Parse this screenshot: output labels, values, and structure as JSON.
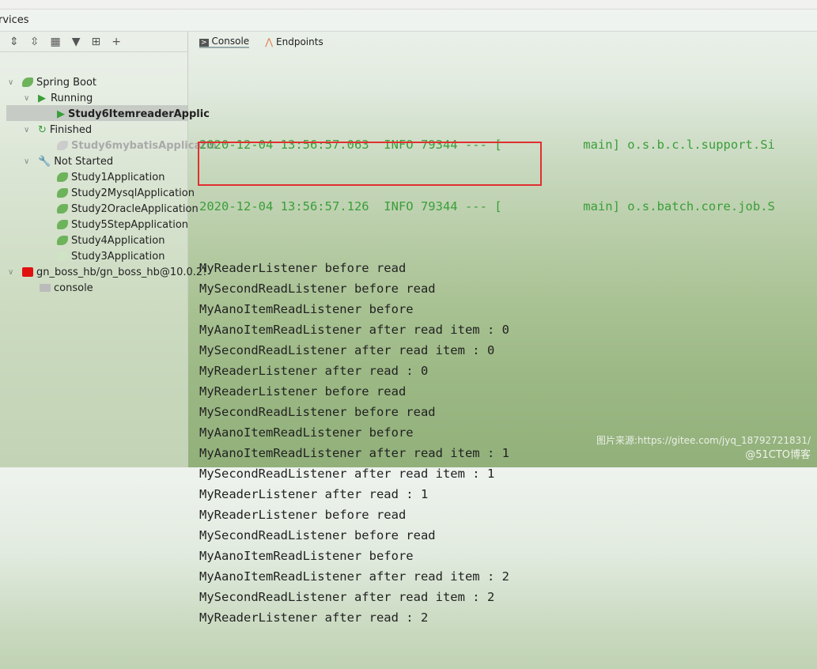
{
  "window": {
    "title": "rvices"
  },
  "toolbar": {
    "icons": [
      "expand-all-icon",
      "collapse-all-icon",
      "group-icon",
      "filter-icon",
      "add-service-icon",
      "add-icon"
    ]
  },
  "tabs": [
    {
      "label": "Console",
      "icon": "console-icon"
    },
    {
      "label": "Endpoints",
      "icon": "endpoints-icon"
    }
  ],
  "tree": {
    "spring_boot": "Spring Boot",
    "running": "Running",
    "running_app": "Study6ItemreaderApplic",
    "finished": "Finished",
    "finished_app": "Study6mybatisApplicatio",
    "not_started": "Not Started",
    "apps": [
      "Study1Application",
      "Study2MysqlApplication",
      "Study2OracleApplication",
      "Study5StepApplication",
      "Study4Application",
      "Study3Application"
    ],
    "db": "gn_boss_hb/gn_boss_hb@10.0.2!",
    "db_console": "console"
  },
  "console": {
    "log_lines": [
      "2020-12-04 13:56:57.063  INFO 79344 --- [           main] o.s.b.c.l.support.Si",
      "2020-12-04 13:56:57.126  INFO 79344 --- [           main] o.s.batch.core.job.S"
    ],
    "lines": [
      "MyReaderListener before read",
      "MySecondReadListener before read",
      "MyAanoItemReadListener before",
      "MyAanoItemReadListener after read item : 0",
      "MySecondReadListener after read item : 0",
      "MyReaderListener after read : 0",
      "MyReaderListener before read",
      "MySecondReadListener before read",
      "MyAanoItemReadListener before",
      "MyAanoItemReadListener after read item : 1",
      "MySecondReadListener after read item : 1",
      "MyReaderListener after read : 1",
      "MyReaderListener before read",
      "MySecondReadListener before read",
      "MyAanoItemReadListener before",
      "MyAanoItemReadListener after read item : 2",
      "MySecondReadListener after read item : 2",
      "MyReaderListener after read : 2"
    ]
  },
  "watermark": {
    "source": "图片来源:https://gitee.com/jyq_18792721831/",
    "brand": "@51CTO博客"
  },
  "colors": {
    "log_green": "#3a9e3a",
    "highlight": "#e03030"
  }
}
